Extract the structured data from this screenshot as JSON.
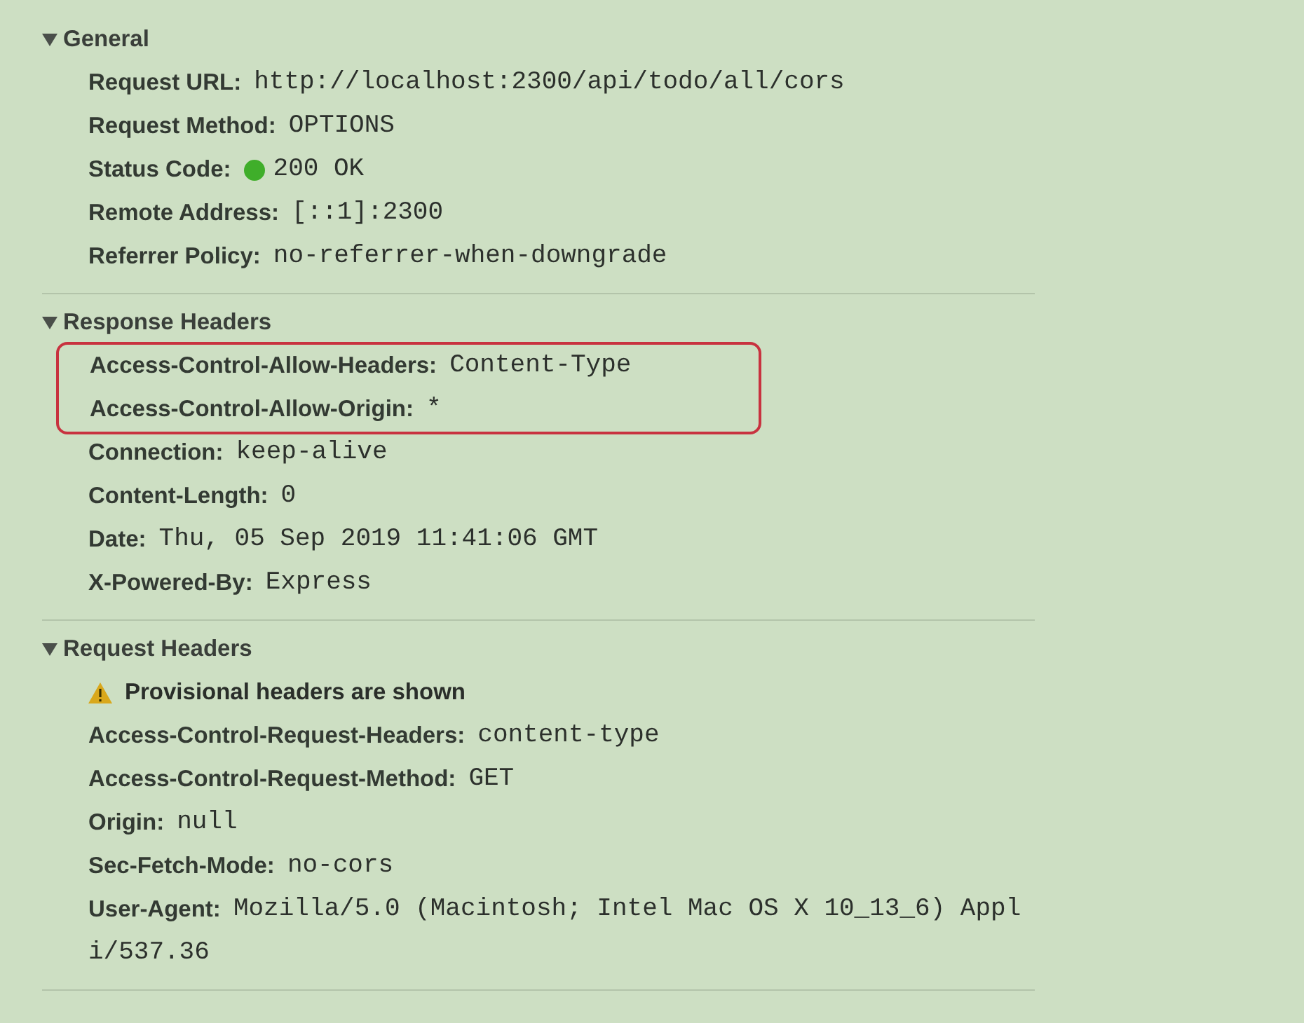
{
  "sections": [
    {
      "title": "General",
      "expanded": true,
      "rows": [
        {
          "kind": "field",
          "name": "Request URL:",
          "value_lines": [
            "http://localhost:2300/api/todo/all/cors"
          ],
          "highlighted": false
        },
        {
          "kind": "field",
          "name": "Request Method:",
          "value_lines": [
            "OPTIONS"
          ],
          "highlighted": false
        },
        {
          "kind": "status",
          "name": "Status Code:",
          "value_lines": [
            "200 OK"
          ],
          "color": "#3fae2a",
          "highlighted": false
        },
        {
          "kind": "field",
          "name": "Remote Address:",
          "value_lines": [
            "[::1]:2300"
          ],
          "highlighted": false
        },
        {
          "kind": "field",
          "name": "Referrer Policy:",
          "value_lines": [
            "no-referrer-when-downgrade"
          ],
          "highlighted": false
        }
      ]
    },
    {
      "title": "Response Headers",
      "expanded": true,
      "rows": [
        {
          "kind": "field",
          "name": "Access-Control-Allow-Headers:",
          "value_lines": [
            "Content-Type"
          ],
          "highlighted": true
        },
        {
          "kind": "field",
          "name": "Access-Control-Allow-Origin:",
          "value_lines": [
            "*"
          ],
          "highlighted": true
        },
        {
          "kind": "field",
          "name": "Connection:",
          "value_lines": [
            "keep-alive"
          ],
          "highlighted": false
        },
        {
          "kind": "field",
          "name": "Content-Length:",
          "value_lines": [
            "0"
          ],
          "highlighted": false
        },
        {
          "kind": "field",
          "name": "Date:",
          "value_lines": [
            "Thu, 05 Sep 2019 11:41:06 GMT"
          ],
          "highlighted": false
        },
        {
          "kind": "field",
          "name": "X-Powered-By:",
          "value_lines": [
            "Express"
          ],
          "highlighted": false
        }
      ]
    },
    {
      "title": "Request Headers",
      "expanded": true,
      "rows": [
        {
          "kind": "warning",
          "name": "Provisional headers are shown",
          "highlighted": false
        },
        {
          "kind": "field",
          "name": "Access-Control-Request-Headers:",
          "value_lines": [
            "content-type"
          ],
          "highlighted": false
        },
        {
          "kind": "field",
          "name": "Access-Control-Request-Method:",
          "value_lines": [
            "GET"
          ],
          "highlighted": false
        },
        {
          "kind": "field",
          "name": "Origin:",
          "value_lines": [
            "null"
          ],
          "highlighted": false
        },
        {
          "kind": "field",
          "name": "Sec-Fetch-Mode:",
          "value_lines": [
            "no-cors"
          ],
          "highlighted": false
        },
        {
          "kind": "field",
          "name": "User-Agent:",
          "value_lines": [
            "Mozilla/5.0 (Macintosh; Intel Mac OS X 10_13_6) Appl",
            "i/537.36"
          ],
          "highlighted": false
        }
      ]
    }
  ]
}
